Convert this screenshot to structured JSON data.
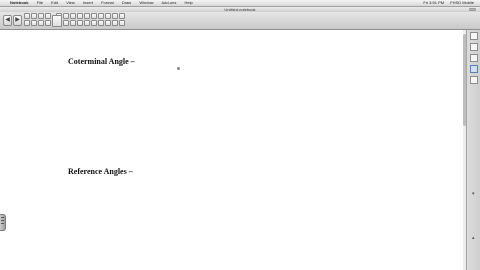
{
  "menubar": {
    "apple": "",
    "menus": [
      "Notebook",
      "File",
      "Edit",
      "View",
      "Insert",
      "Format",
      "Draw",
      "Window",
      "Add-ons",
      "Help"
    ],
    "right": [
      "Fri 3:51 PM",
      "FHSD Mobile"
    ]
  },
  "window": {
    "title": "Untitled.notebook"
  },
  "toolbar": {
    "prev_icon": "◀",
    "next_icon": "▶"
  },
  "page": {
    "headings": [
      "Coterminal Angle –",
      "Reference Angles –"
    ]
  },
  "sidebar": {
    "tabs": [
      "page-sorter-icon",
      "gallery-icon",
      "attachments-icon",
      "properties-icon",
      "addons-icon"
    ]
  },
  "colors": {
    "page": "#ffffff",
    "chrome": "#d9d9d9",
    "active": "#cfe0f5"
  }
}
